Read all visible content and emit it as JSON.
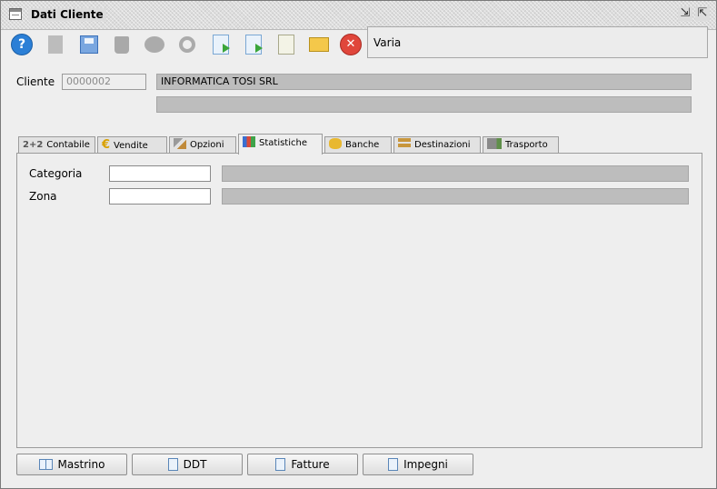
{
  "window": {
    "title": "Dati Cliente"
  },
  "toolbar": {
    "status_text": "Varia",
    "buttons": [
      {
        "name": "help-icon"
      },
      {
        "name": "new-doc-icon"
      },
      {
        "name": "save-icon"
      },
      {
        "name": "trash-icon"
      },
      {
        "name": "group-icon"
      },
      {
        "name": "search-key-icon"
      },
      {
        "name": "import-icon"
      },
      {
        "name": "export-icon"
      },
      {
        "name": "report-icon"
      },
      {
        "name": "mail-icon"
      },
      {
        "name": "close-icon"
      }
    ]
  },
  "cliente": {
    "label": "Cliente",
    "code": "0000002",
    "name": "INFORMATICA TOSI SRL",
    "name2": ""
  },
  "tabs": [
    {
      "prefix": "2+2",
      "label": "Contabile"
    },
    {
      "label": "Vendite",
      "icon": "euro-icon"
    },
    {
      "label": "Opzioni",
      "icon": "tools-icon"
    },
    {
      "label": "Statistiche",
      "icon": "chart-icon",
      "active": true
    },
    {
      "label": "Banche",
      "icon": "coins-icon"
    },
    {
      "label": "Destinazioni",
      "icon": "signpost-icon"
    },
    {
      "label": "Trasporto",
      "icon": "truck-icon"
    }
  ],
  "statistiche": {
    "categoria": {
      "label": "Categoria",
      "code": "",
      "description": ""
    },
    "zona": {
      "label": "Zona",
      "code": "",
      "description": ""
    }
  },
  "bottom_buttons": [
    {
      "label": "Mastrino",
      "icon": "book-icon"
    },
    {
      "label": "DDT",
      "icon": "document-icon"
    },
    {
      "label": "Fatture",
      "icon": "document-icon"
    },
    {
      "label": "Impegni",
      "icon": "document-icon"
    }
  ],
  "colors": {
    "accent": "#2b7fd6",
    "readonly_field": "#bdbdbd",
    "background": "#eeeeee"
  }
}
